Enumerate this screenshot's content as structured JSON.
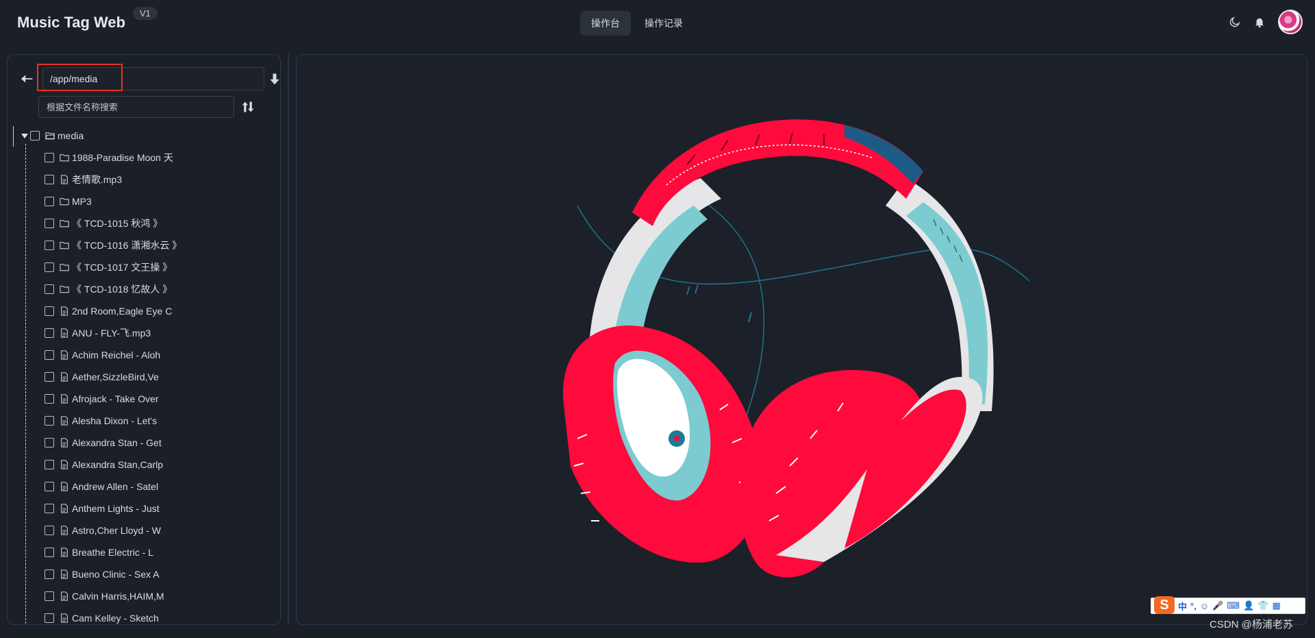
{
  "header": {
    "app_title": "Music Tag Web",
    "version": "V1",
    "tabs": [
      {
        "label": "操作台",
        "active": true
      },
      {
        "label": "操作记录",
        "active": false
      }
    ],
    "icons": [
      "moon-icon",
      "bell-icon",
      "avatar"
    ]
  },
  "sidebar": {
    "path_value": "/app/media",
    "search_placeholder": "根据文件名称搜索",
    "root": {
      "name": "media",
      "expanded": true
    },
    "items": [
      {
        "name": "1988-Paradise Moon 天",
        "type": "folder"
      },
      {
        "name": "老情歌.mp3",
        "type": "file"
      },
      {
        "name": "MP3",
        "type": "folder"
      },
      {
        "name": "《 TCD-1015 秋鸿 》",
        "type": "folder"
      },
      {
        "name": "《 TCD-1016 潇湘水云 》",
        "type": "folder"
      },
      {
        "name": "《 TCD-1017 文王操 》",
        "type": "folder"
      },
      {
        "name": "《 TCD-1018 忆故人 》",
        "type": "folder"
      },
      {
        "name": "2nd Room,Eagle Eye C",
        "type": "file"
      },
      {
        "name": "ANU - FLY-飞.mp3",
        "type": "file"
      },
      {
        "name": "Achim Reichel - Aloh",
        "type": "file"
      },
      {
        "name": "Aether,SizzleBird,Ve",
        "type": "file"
      },
      {
        "name": "Afrojack - Take Over",
        "type": "file"
      },
      {
        "name": "Alesha Dixon - Let's",
        "type": "file"
      },
      {
        "name": "Alexandra Stan - Get",
        "type": "file"
      },
      {
        "name": "Alexandra Stan,Carlp",
        "type": "file"
      },
      {
        "name": "Andrew Allen - Satel",
        "type": "file"
      },
      {
        "name": "Anthem Lights - Just",
        "type": "file"
      },
      {
        "name": "Astro,Cher Lloyd - W",
        "type": "file"
      },
      {
        "name": "Breathe Electric - L",
        "type": "file"
      },
      {
        "name": "Bueno Clinic - Sex A",
        "type": "file"
      },
      {
        "name": "Calvin Harris,HAIM,M",
        "type": "file"
      },
      {
        "name": "Cam Kelley - Sketch",
        "type": "file"
      }
    ]
  },
  "ime": {
    "items": [
      "中",
      "°,",
      "☺",
      "🎤",
      "⌨",
      "👤",
      "👕",
      "▦"
    ]
  },
  "watermark": "CSDN @杨浦老苏",
  "colors": {
    "background": "#1b1f26",
    "panel_border": "#2a3a52",
    "highlight_box": "#e6312d",
    "headphone_red": "#ff0a3c",
    "headphone_teal": "#7ccbd0",
    "headphone_grey": "#e6e6e8"
  }
}
